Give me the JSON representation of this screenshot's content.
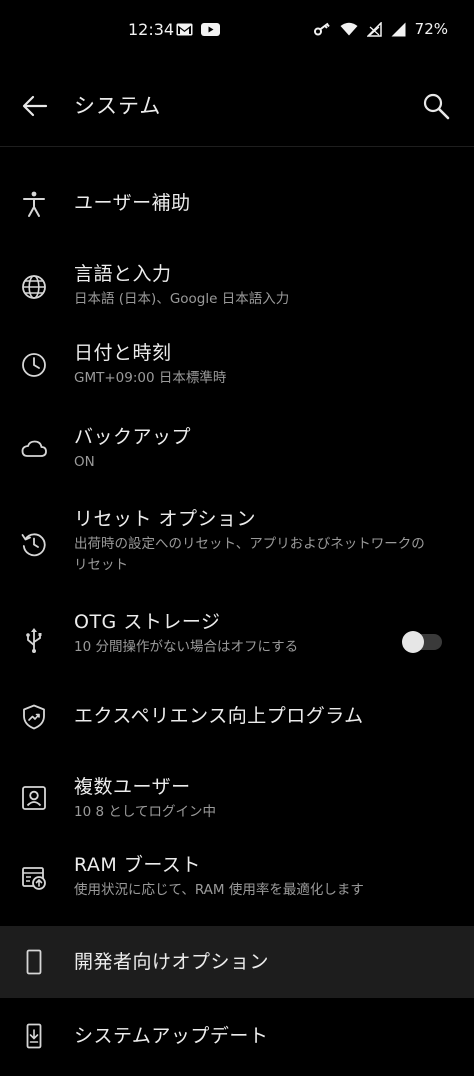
{
  "status_bar": {
    "time": "12:34",
    "battery": "72%",
    "left_icons": [
      "gmail-icon",
      "youtube-icon"
    ],
    "right_icons": [
      "vpn-key-icon",
      "wifi-icon",
      "no-signal-icon",
      "signal-icon"
    ]
  },
  "header": {
    "title": "システム"
  },
  "items": [
    {
      "title": "ユーザー補助",
      "subtitle": "",
      "icon": "accessibility-icon"
    },
    {
      "title": "言語と入力",
      "subtitle": "日本語 (日本)、Google 日本語入力",
      "icon": "globe-icon"
    },
    {
      "title": "日付と時刻",
      "subtitle": "GMT+09:00 日本標準時",
      "icon": "clock-icon"
    },
    {
      "title": "バックアップ",
      "subtitle": "ON",
      "icon": "cloud-icon"
    },
    {
      "title": "リセット オプション",
      "subtitle": "出荷時の設定へのリセット、アプリおよびネットワークのリセット",
      "icon": "history-icon"
    },
    {
      "title": "OTG ストレージ",
      "subtitle": "10 分間操作がない場合はオフにする",
      "icon": "usb-icon",
      "toggle_on": false
    },
    {
      "title": "エクスペリエンス向上プログラム",
      "subtitle": "",
      "icon": "shield-chart-icon"
    },
    {
      "title": "複数ユーザー",
      "subtitle": "10 8 としてログイン中",
      "icon": "user-icon"
    },
    {
      "title": "RAM ブースト",
      "subtitle": "使用状況に応じて、RAM 使用率を最適化します",
      "icon": "ram-boost-icon"
    },
    {
      "title": "開発者向けオプション",
      "subtitle": "",
      "icon": "phone-icon",
      "highlighted": true
    },
    {
      "title": "システムアップデート",
      "subtitle": "",
      "icon": "system-update-icon"
    }
  ]
}
